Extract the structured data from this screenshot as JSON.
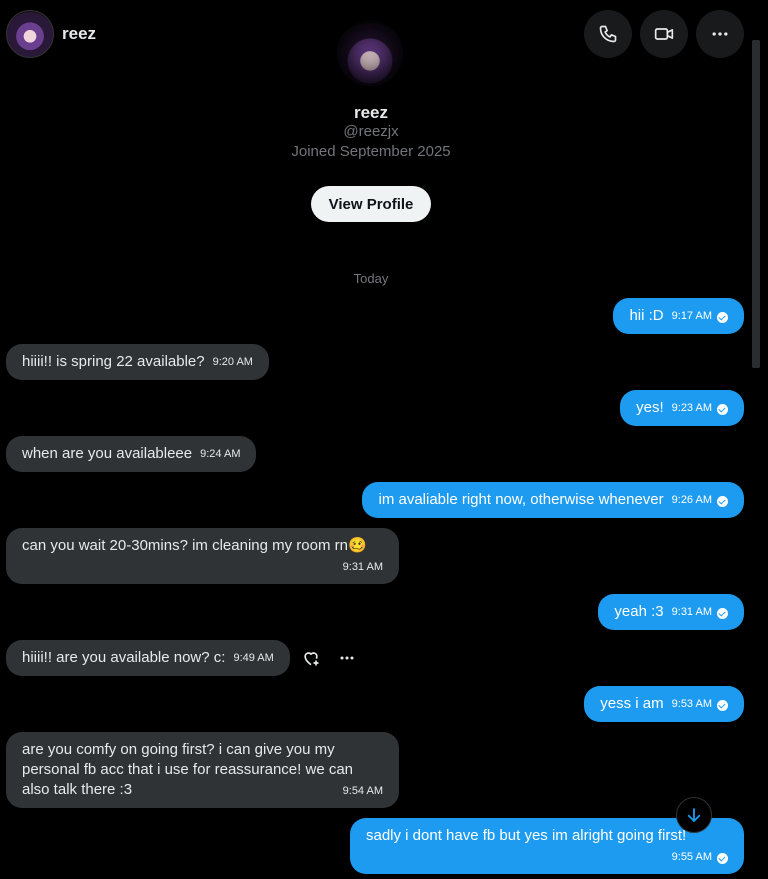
{
  "header": {
    "username": "reez",
    "call_icon": "phone-icon",
    "video_icon": "video-camera-icon",
    "more_icon": "ellipsis-icon"
  },
  "profile": {
    "name": "reez",
    "handle": "@reezjx",
    "joined": "Joined September 2025",
    "view_profile_label": "View Profile"
  },
  "date_divider": "Today",
  "colors": {
    "sent_bubble": "#1d9bf0",
    "received_bubble": "#2f3336",
    "background": "#000000"
  },
  "messages": [
    {
      "direction": "sent",
      "text": "hii :D",
      "time": "9:17 AM"
    },
    {
      "direction": "received",
      "text": "hiiii!! is spring 22 available?",
      "time": "9:20 AM"
    },
    {
      "direction": "sent",
      "text": "yes!",
      "time": "9:23 AM"
    },
    {
      "direction": "received",
      "text": "when are you availableee",
      "time": "9:24 AM"
    },
    {
      "direction": "sent",
      "text": "im avaliable right now, otherwise whenever",
      "time": "9:26 AM"
    },
    {
      "direction": "received",
      "text": "can you wait 20-30mins? im cleaning my room rn🥴",
      "time": "9:31 AM"
    },
    {
      "direction": "sent",
      "text": "yeah :3",
      "time": "9:31 AM"
    },
    {
      "direction": "received",
      "text": "hiiii!! are you available now? c:",
      "time": "9:49 AM"
    },
    {
      "direction": "sent",
      "text": "yess i am",
      "time": "9:53 AM"
    },
    {
      "direction": "received",
      "text": [
        "are you comfy on going first? i can give you my",
        "personal fb acc that i use for reassurance! we can",
        "also talk there :3"
      ],
      "time": "9:54 AM"
    },
    {
      "direction": "sent",
      "text": "sadly i dont have fb but yes im alright going first!",
      "time": "9:55 AM"
    }
  ]
}
